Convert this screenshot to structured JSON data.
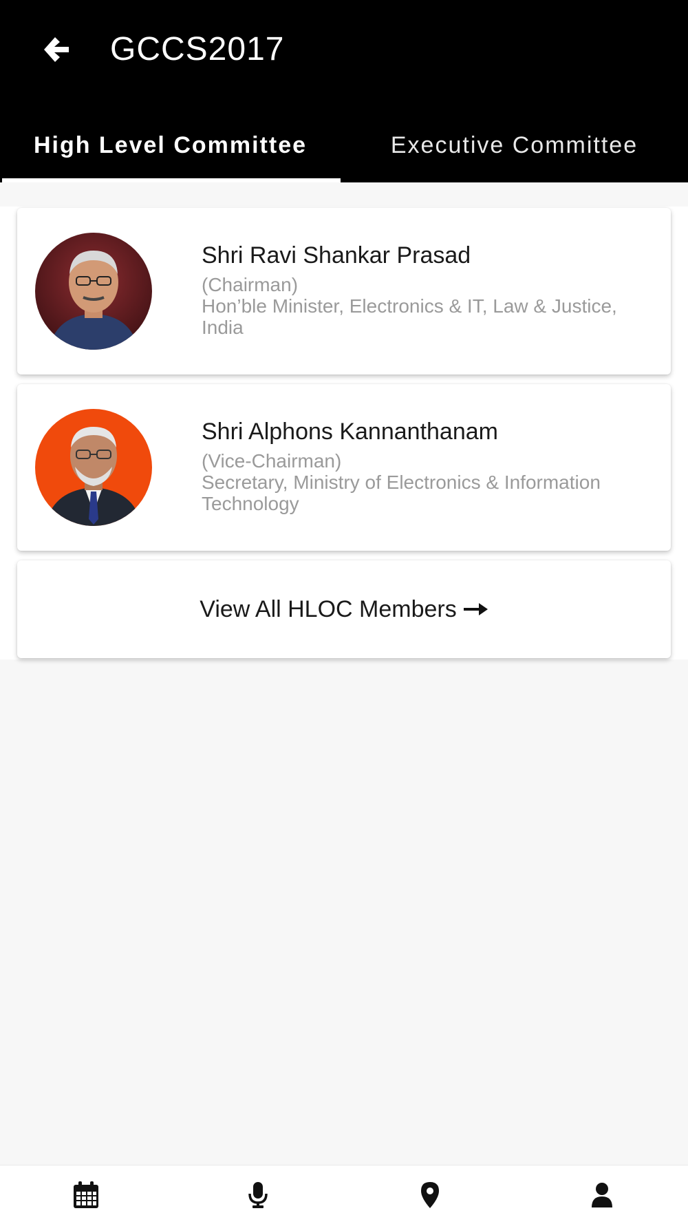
{
  "app": {
    "title": "GCCS2017"
  },
  "tabs": [
    {
      "label": "High Level Committee",
      "active": true
    },
    {
      "label": "Executive Committee",
      "active": false
    }
  ],
  "members": [
    {
      "name": "Shri Ravi Shankar Prasad",
      "role": "(Chairman)",
      "position": "Hon’ble Minister, Electronics & IT, Law & Justice, India",
      "avatar_bg": "#6b1f22"
    },
    {
      "name": "Shri Alphons Kannanthanam",
      "role": "(Vice-Chairman)",
      "position": "Secretary, Ministry of Electronics & Information Technology",
      "avatar_bg": "#f04a0c"
    }
  ],
  "view_all": {
    "label": "View All HLOC Members"
  },
  "bottom_nav": [
    {
      "icon": "calendar-icon"
    },
    {
      "icon": "microphone-icon"
    },
    {
      "icon": "map-pin-icon"
    },
    {
      "icon": "user-icon"
    }
  ],
  "colors": {
    "header": "#000000",
    "background": "#f7f7f7",
    "secondary_text": "#9a9a9a"
  }
}
